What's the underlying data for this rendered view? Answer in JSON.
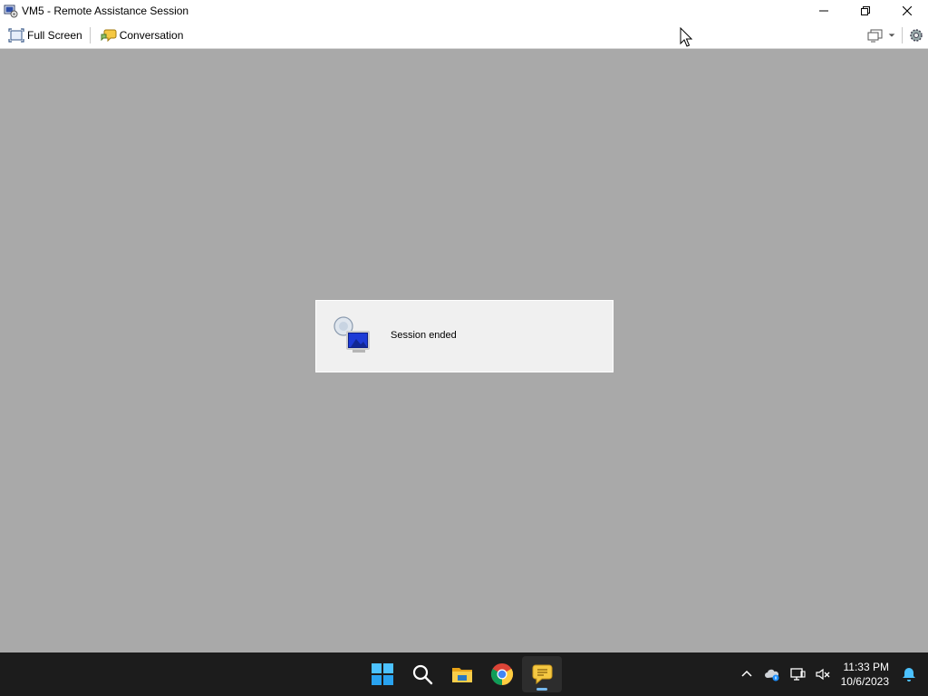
{
  "window": {
    "title": "VM5 - Remote Assistance Session",
    "icons": {
      "app": "remote-assistance-icon",
      "minimize": "minimize-icon",
      "restore": "restore-icon",
      "close": "close-icon"
    }
  },
  "toolbar": {
    "full_screen_label": "Full Screen",
    "conversation_label": "Conversation",
    "icons": {
      "full_screen": "fullscreen-icon",
      "conversation": "chat-icon",
      "display": "monitor-icon",
      "dropdown": "chevron-down-icon",
      "settings": "settings-icon"
    }
  },
  "dialog": {
    "message": "Session ended",
    "icon": "network-monitor-icon"
  },
  "taskbar": {
    "pinned": [
      "windows-start-icon",
      "search-icon",
      "file-explorer-icon",
      "chrome-icon",
      "remote-assistance-icon"
    ],
    "active_index": 4,
    "tray_icons": [
      "chevron-up-icon",
      "onedrive-icon",
      "network-icon",
      "volume-muted-icon",
      "notification-bell-icon"
    ],
    "clock": {
      "time": "11:33 PM",
      "date": "10/6/2023"
    }
  },
  "colors": {
    "workspace": "#a9a9a9",
    "taskbar": "#1c1c1c",
    "dialog": "#f0f0f0",
    "accent": "#76b9ed"
  }
}
